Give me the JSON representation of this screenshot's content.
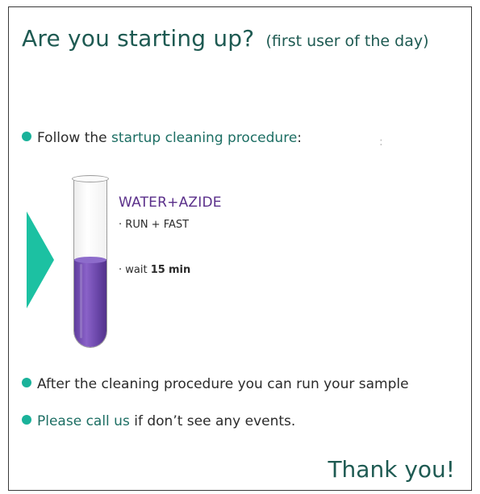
{
  "header": {
    "title": "Are you starting up?",
    "subtitle": "(first user of the day)"
  },
  "step1": {
    "prefix": "Follow the",
    "link": "startup cleaning procedure",
    "suffix": ":",
    "mark": ":"
  },
  "procedure": {
    "reagent": "WATER+AZIDE",
    "run_prefix": "·",
    "run_label": "RUN + FAST",
    "wait_prefix": "· wait",
    "wait_value": "15",
    "wait_unit": "min",
    "fill_level": 0.52
  },
  "step2": {
    "text": "After the cleaning procedure you can run your sample"
  },
  "step3": {
    "link": "Please call us",
    "suffix": "if don’t see any events."
  },
  "footer": {
    "thanks": "Thank you!"
  },
  "colors": {
    "teal_accent": "#1ab29a",
    "title_color": "#1e5a52",
    "liquid_purple": "#7a55bd",
    "reagent_text": "#5a2f8a"
  }
}
